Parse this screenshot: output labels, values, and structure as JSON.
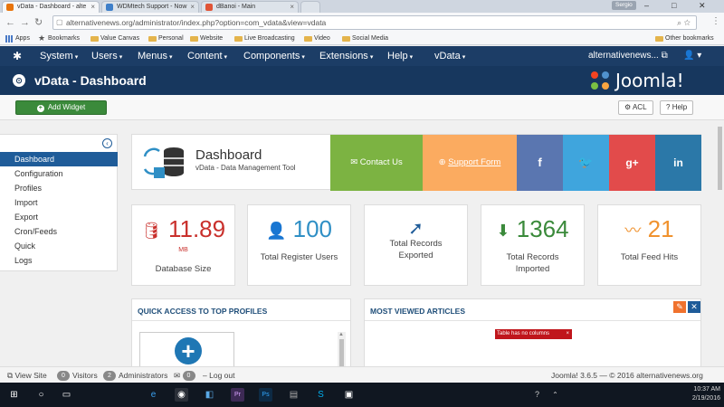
{
  "browser": {
    "tabs": [
      {
        "label": "vData - Dashboard - alte",
        "color": "#e8740c"
      },
      {
        "label": "WDMtech Support - Now",
        "color": "#3f7fc9"
      },
      {
        "label": "dBanoi - Main",
        "color": "#e05436"
      }
    ],
    "user": "Sergio",
    "url": "alternativenews.org/administrator/index.php?option=com_vdata&view=vdata",
    "bookmarks": [
      "Apps",
      "Bookmarks",
      "Value Canvas",
      "Personal",
      "Website",
      "Live Broadcasting",
      "Video",
      "Social Media"
    ],
    "other_bookmarks": "Other bookmarks"
  },
  "topbar": {
    "menus": [
      "System",
      "Users",
      "Menus",
      "Content",
      "Components",
      "Extensions",
      "Help",
      "vData"
    ],
    "site": "alternativenews...",
    "user_icon": "user-icon"
  },
  "header": {
    "title": "vData - Dashboard",
    "brand": "Joomla!"
  },
  "toolbar": {
    "add_widget": "Add Widget",
    "acl": "ACL",
    "help": "Help"
  },
  "sidebar": {
    "items": [
      "Dashboard",
      "Configuration",
      "Profiles",
      "Import",
      "Export",
      "Cron/Feeds",
      "Quick",
      "Logs"
    ],
    "active_index": 0
  },
  "dashboard": {
    "title": "Dashboard",
    "subtitle": "vData - Data Management Tool",
    "tiles": [
      {
        "label": "Contact Us",
        "color": "#7cb342",
        "icon": "envelope-icon"
      },
      {
        "label": "Support Form",
        "color": "#fbab60",
        "icon": "globe-icon"
      },
      {
        "label": "f",
        "color": "#5a76b0",
        "icon": "facebook-icon"
      },
      {
        "label": "t",
        "color": "#3fa5dd",
        "icon": "twitter-icon"
      },
      {
        "label": "g+",
        "color": "#e24b4b",
        "icon": "google-plus-icon"
      },
      {
        "label": "in",
        "color": "#2b78a8",
        "icon": "linkedin-icon"
      }
    ]
  },
  "stats": [
    {
      "value": "11.89",
      "unit": "MB",
      "label": "Database Size",
      "color": "#c9302c",
      "icon": "database-icon"
    },
    {
      "value": "100",
      "unit": "",
      "label": "Total Register Users",
      "color": "#2f8fc5",
      "icon": "user-icon"
    },
    {
      "value": "",
      "unit": "",
      "label": "Total Records Exported",
      "color": "#1f5c99",
      "icon": "export-icon"
    },
    {
      "value": "1364",
      "unit": "",
      "label": "Total Records Imported",
      "color": "#3b8a3b",
      "icon": "import-icon"
    },
    {
      "value": "21",
      "unit": "",
      "label": "Total Feed Hits",
      "color": "#f0922e",
      "icon": "rss-icon"
    }
  ],
  "panels": {
    "quick_access_title": "QUICK ACCESS TO TOP PROFILES",
    "most_viewed_title": "MOST VIEWED ARTICLES",
    "error_text": "Table has no columns"
  },
  "statusbar": {
    "view_site": "View Site",
    "visitors_count": "0",
    "visitors": "Visitors",
    "admins_count": "2",
    "admins": "Administrators",
    "messages_count": "0",
    "logout": "Log out",
    "version": "Joomla! 3.6.5 — © 2016 alternativenews.org"
  },
  "taskbar": {
    "time": "10:37 AM",
    "date": "2/19/2016"
  }
}
